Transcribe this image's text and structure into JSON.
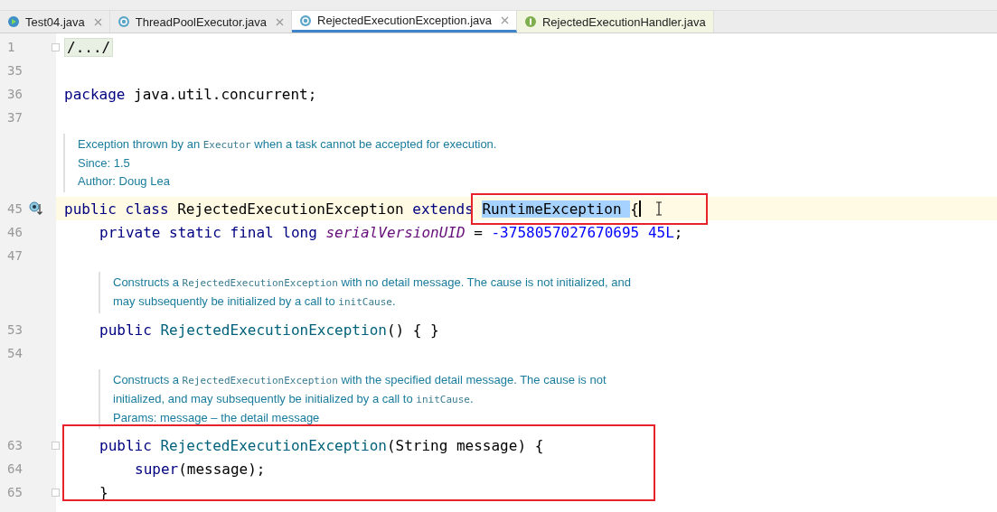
{
  "tabs": [
    {
      "label": "Test04.java",
      "kind": "runnable",
      "selected": false,
      "closable": true
    },
    {
      "label": "ThreadPoolExecutor.java",
      "kind": "class",
      "selected": false,
      "closable": true
    },
    {
      "label": "RejectedExecutionException.java",
      "kind": "class",
      "selected": true,
      "closable": true
    },
    {
      "label": "RejectedExecutionHandler.java",
      "kind": "interface",
      "selected": false,
      "closable": false
    }
  ],
  "editor": {
    "lines": [
      {
        "kind": "code",
        "number": "1",
        "fold": true,
        "current": false,
        "tokens": [
          {
            "text": "/.../",
            "kind": "folded"
          }
        ]
      },
      {
        "kind": "code",
        "number": "35",
        "current": false
      },
      {
        "kind": "code",
        "number": "36",
        "current": false,
        "tokens": [
          {
            "text": "package ",
            "kind": "keyword"
          },
          {
            "text": "java.util.concurrent;",
            "kind": "plain"
          }
        ]
      },
      {
        "kind": "code",
        "number": "37",
        "current": false
      },
      {
        "kind": "doc",
        "paragraphs": [
          [
            {
              "text": "Exception thrown by an "
            },
            {
              "text": "Executor",
              "code": true
            },
            {
              "text": " when a task cannot be accepted for execution."
            }
          ],
          [
            {
              "text": "Since:   1.5"
            }
          ],
          [
            {
              "text": "Author: Doug Lea"
            }
          ]
        ]
      },
      {
        "kind": "code",
        "number": "45",
        "overrides": true,
        "current": true,
        "tokens": [
          {
            "text": "public class ",
            "kind": "keyword"
          },
          {
            "text": "RejectedExecutionException ",
            "kind": "plain"
          },
          {
            "text": "extends ",
            "kind": "keyword"
          },
          {
            "text": "RuntimeException ",
            "kind": "plain",
            "highlighted": true,
            "boxed": true
          },
          {
            "text": "{",
            "kind": "plain",
            "boxed": true,
            "cursor": true
          }
        ],
        "children": [
          {
            "kind": "code",
            "number": "46",
            "current": false,
            "tokens": [
              {
                "text": "private static final long ",
                "kind": "keyword"
              },
              {
                "text": "serialVersionUID",
                "kind": "field"
              },
              {
                "text": " = ",
                "kind": "plain"
              },
              {
                "text": "-3758057027670695 45L",
                "kind": "number"
              },
              {
                "text": ";",
                "kind": "plain"
              }
            ]
          },
          {
            "kind": "code",
            "number": "47",
            "current": false
          },
          {
            "kind": "doc",
            "paragraphs": [
              [
                {
                  "text": "Constructs a "
                },
                {
                  "text": "RejectedExecutionException",
                  "code": true
                },
                {
                  "text": " with no detail message. The cause is not initialized, and"
                }
              ],
              [
                {
                  "text": "may subsequently be initialized by a call to "
                },
                {
                  "text": "initCause",
                  "code": true
                },
                {
                  "text": "."
                }
              ]
            ]
          },
          {
            "kind": "code",
            "number": "53",
            "current": false,
            "tokens": [
              {
                "text": "public ",
                "kind": "keyword"
              },
              {
                "text": "RejectedExecutionException",
                "kind": "method"
              },
              {
                "text": "() { }",
                "kind": "plain"
              }
            ]
          },
          {
            "kind": "code",
            "number": "54",
            "current": false
          },
          {
            "kind": "doc",
            "paragraphs": [
              [
                {
                  "text": "Constructs a "
                },
                {
                  "text": "RejectedExecutionException",
                  "code": true
                },
                {
                  "text": " with the specified detail message. The cause is not"
                }
              ],
              [
                {
                  "text": "initialized, and may subsequently be initialized by a call to "
                },
                {
                  "text": "initCause",
                  "code": true
                },
                {
                  "text": "."
                }
              ],
              [
                {
                  "text": "Params: message – the detail message"
                }
              ]
            ]
          },
          {
            "kind": "group",
            "boxed": true,
            "children": [
              {
                "kind": "code",
                "number": "63",
                "fold": true,
                "current": false,
                "tokens": [
                  {
                    "text": "public ",
                    "kind": "keyword"
                  },
                  {
                    "text": "RejectedExecutionException",
                    "kind": "method"
                  },
                  {
                    "text": "(String message) {",
                    "kind": "plain"
                  }
                ],
                "children": [
                  {
                    "kind": "code",
                    "number": "64",
                    "current": false,
                    "tokens": [
                      {
                        "text": "super",
                        "kind": "keyword"
                      },
                      {
                        "text": "(message);",
                        "kind": "plain"
                      }
                    ]
                  }
                ]
              },
              {
                "kind": "code",
                "number": "65",
                "fold": true,
                "current": false,
                "tokens": [
                  {
                    "text": "}",
                    "kind": "plain"
                  }
                ]
              }
            ]
          }
        ]
      }
    ]
  }
}
